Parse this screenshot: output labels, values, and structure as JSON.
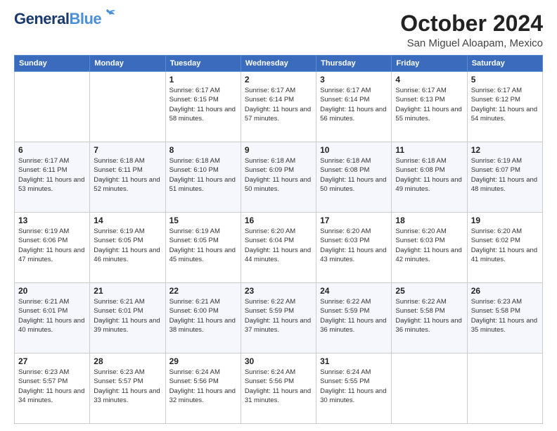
{
  "header": {
    "logo_general": "General",
    "logo_blue": "Blue",
    "month": "October 2024",
    "location": "San Miguel Aloapam, Mexico"
  },
  "days_of_week": [
    "Sunday",
    "Monday",
    "Tuesday",
    "Wednesday",
    "Thursday",
    "Friday",
    "Saturday"
  ],
  "weeks": [
    [
      {
        "day": "",
        "info": ""
      },
      {
        "day": "",
        "info": ""
      },
      {
        "day": "1",
        "info": "Sunrise: 6:17 AM\nSunset: 6:15 PM\nDaylight: 11 hours and 58 minutes."
      },
      {
        "day": "2",
        "info": "Sunrise: 6:17 AM\nSunset: 6:14 PM\nDaylight: 11 hours and 57 minutes."
      },
      {
        "day": "3",
        "info": "Sunrise: 6:17 AM\nSunset: 6:14 PM\nDaylight: 11 hours and 56 minutes."
      },
      {
        "day": "4",
        "info": "Sunrise: 6:17 AM\nSunset: 6:13 PM\nDaylight: 11 hours and 55 minutes."
      },
      {
        "day": "5",
        "info": "Sunrise: 6:17 AM\nSunset: 6:12 PM\nDaylight: 11 hours and 54 minutes."
      }
    ],
    [
      {
        "day": "6",
        "info": "Sunrise: 6:17 AM\nSunset: 6:11 PM\nDaylight: 11 hours and 53 minutes."
      },
      {
        "day": "7",
        "info": "Sunrise: 6:18 AM\nSunset: 6:11 PM\nDaylight: 11 hours and 52 minutes."
      },
      {
        "day": "8",
        "info": "Sunrise: 6:18 AM\nSunset: 6:10 PM\nDaylight: 11 hours and 51 minutes."
      },
      {
        "day": "9",
        "info": "Sunrise: 6:18 AM\nSunset: 6:09 PM\nDaylight: 11 hours and 50 minutes."
      },
      {
        "day": "10",
        "info": "Sunrise: 6:18 AM\nSunset: 6:08 PM\nDaylight: 11 hours and 50 minutes."
      },
      {
        "day": "11",
        "info": "Sunrise: 6:18 AM\nSunset: 6:08 PM\nDaylight: 11 hours and 49 minutes."
      },
      {
        "day": "12",
        "info": "Sunrise: 6:19 AM\nSunset: 6:07 PM\nDaylight: 11 hours and 48 minutes."
      }
    ],
    [
      {
        "day": "13",
        "info": "Sunrise: 6:19 AM\nSunset: 6:06 PM\nDaylight: 11 hours and 47 minutes."
      },
      {
        "day": "14",
        "info": "Sunrise: 6:19 AM\nSunset: 6:05 PM\nDaylight: 11 hours and 46 minutes."
      },
      {
        "day": "15",
        "info": "Sunrise: 6:19 AM\nSunset: 6:05 PM\nDaylight: 11 hours and 45 minutes."
      },
      {
        "day": "16",
        "info": "Sunrise: 6:20 AM\nSunset: 6:04 PM\nDaylight: 11 hours and 44 minutes."
      },
      {
        "day": "17",
        "info": "Sunrise: 6:20 AM\nSunset: 6:03 PM\nDaylight: 11 hours and 43 minutes."
      },
      {
        "day": "18",
        "info": "Sunrise: 6:20 AM\nSunset: 6:03 PM\nDaylight: 11 hours and 42 minutes."
      },
      {
        "day": "19",
        "info": "Sunrise: 6:20 AM\nSunset: 6:02 PM\nDaylight: 11 hours and 41 minutes."
      }
    ],
    [
      {
        "day": "20",
        "info": "Sunrise: 6:21 AM\nSunset: 6:01 PM\nDaylight: 11 hours and 40 minutes."
      },
      {
        "day": "21",
        "info": "Sunrise: 6:21 AM\nSunset: 6:01 PM\nDaylight: 11 hours and 39 minutes."
      },
      {
        "day": "22",
        "info": "Sunrise: 6:21 AM\nSunset: 6:00 PM\nDaylight: 11 hours and 38 minutes."
      },
      {
        "day": "23",
        "info": "Sunrise: 6:22 AM\nSunset: 5:59 PM\nDaylight: 11 hours and 37 minutes."
      },
      {
        "day": "24",
        "info": "Sunrise: 6:22 AM\nSunset: 5:59 PM\nDaylight: 11 hours and 36 minutes."
      },
      {
        "day": "25",
        "info": "Sunrise: 6:22 AM\nSunset: 5:58 PM\nDaylight: 11 hours and 36 minutes."
      },
      {
        "day": "26",
        "info": "Sunrise: 6:23 AM\nSunset: 5:58 PM\nDaylight: 11 hours and 35 minutes."
      }
    ],
    [
      {
        "day": "27",
        "info": "Sunrise: 6:23 AM\nSunset: 5:57 PM\nDaylight: 11 hours and 34 minutes."
      },
      {
        "day": "28",
        "info": "Sunrise: 6:23 AM\nSunset: 5:57 PM\nDaylight: 11 hours and 33 minutes."
      },
      {
        "day": "29",
        "info": "Sunrise: 6:24 AM\nSunset: 5:56 PM\nDaylight: 11 hours and 32 minutes."
      },
      {
        "day": "30",
        "info": "Sunrise: 6:24 AM\nSunset: 5:56 PM\nDaylight: 11 hours and 31 minutes."
      },
      {
        "day": "31",
        "info": "Sunrise: 6:24 AM\nSunset: 5:55 PM\nDaylight: 11 hours and 30 minutes."
      },
      {
        "day": "",
        "info": ""
      },
      {
        "day": "",
        "info": ""
      }
    ]
  ]
}
